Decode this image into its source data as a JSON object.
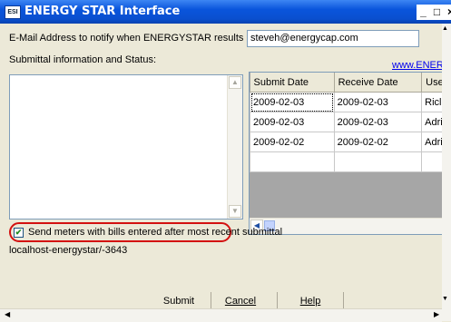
{
  "window": {
    "app_icon_text": "ESI",
    "title": "ENERGY STAR Interface",
    "minimize": "_",
    "maximize": "□",
    "close": "×"
  },
  "email": {
    "label": "E-Mail Address to notify when ENERGYSTAR results are available:",
    "value": "steveh@energycap.com"
  },
  "submittal": {
    "label": "Submittal information and Status:",
    "link": "www.ENERGY"
  },
  "grid": {
    "columns": [
      "Submit Date",
      "Receive Date",
      "Use"
    ],
    "rows": [
      [
        "2009-02-03",
        "2009-02-03",
        "Ricl"
      ],
      [
        "2009-02-03",
        "2009-02-03",
        "Adri"
      ],
      [
        "2009-02-02",
        "2009-02-02",
        "Adri"
      ],
      [
        "",
        "",
        ""
      ]
    ]
  },
  "checkbox": {
    "checked": true,
    "mark": "✔",
    "label": "Send meters with bills entered after most recent submittal"
  },
  "server": "localhost-energystar/-3643",
  "buttons": {
    "submit": "Submit",
    "cancel": "Cancel",
    "help": "Help"
  },
  "scroll_glyphs": {
    "up": "▲",
    "down": "▼",
    "left": "◀",
    "right": "▶"
  }
}
